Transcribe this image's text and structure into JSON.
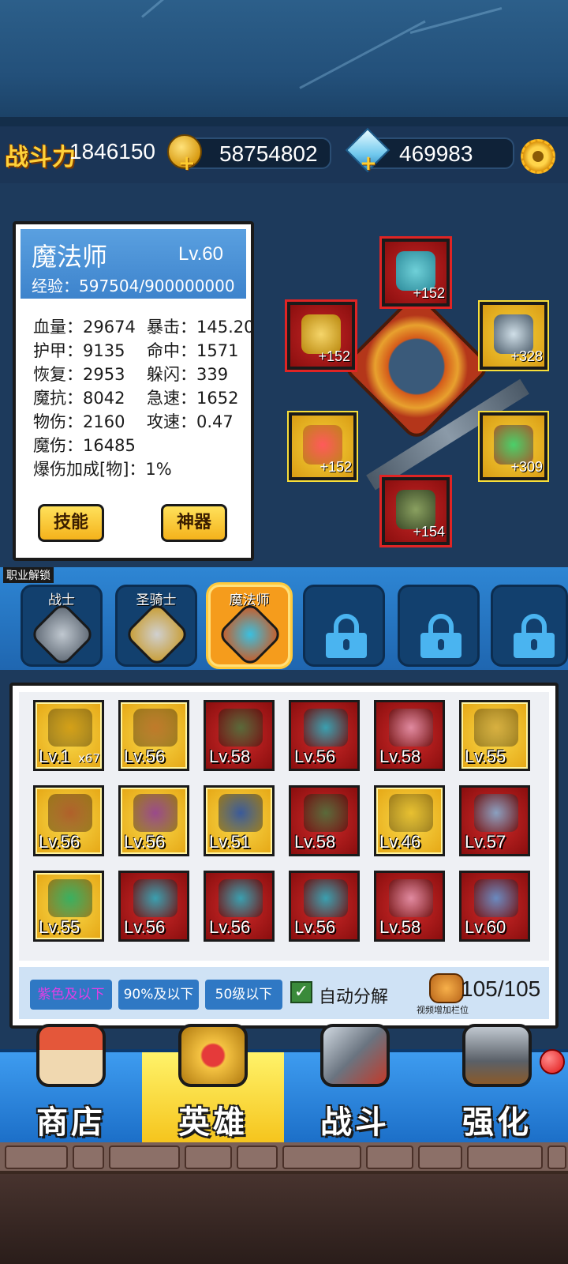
{
  "header": {
    "power_label": "战斗力",
    "power_value": "1846150",
    "gold_value": "58754802",
    "gem_value": "469983",
    "plus_symbol": "+",
    "gear_icon": "gear-icon"
  },
  "hero": {
    "name": "魔法师",
    "level": "Lv.60",
    "exp": "经验：597504/900000000",
    "stats_left": [
      "血量：29674",
      "护甲：9135",
      "恢复：2953",
      "魔抗：8042",
      "物伤：2160",
      "魔伤：16485",
      "爆伤加成[物]：1%"
    ],
    "stats_right": [
      "暴击：145.20",
      "命中：1571",
      "躲闪：339",
      "急速：1652",
      "攻速：0.47"
    ],
    "skill_button": "技能",
    "artifact_button": "神器"
  },
  "equipment": {
    "helmet_plus": "+152",
    "armor_plus": "+152",
    "weapon_plus": "+328",
    "amulet_plus": "+152",
    "ring_plus": "+309",
    "boots_plus": "+154"
  },
  "classes": {
    "bar_label": "职业解锁",
    "items": [
      "战士",
      "圣骑士",
      "魔法师"
    ]
  },
  "inventory": {
    "items": [
      {
        "level": "Lv.1",
        "count": "x67",
        "color": "#e5a614"
      },
      {
        "level": "Lv.56",
        "count": "",
        "color": "#e5a614"
      },
      {
        "level": "Lv.58",
        "count": "",
        "color": "#8a0e0e"
      },
      {
        "level": "Lv.56",
        "count": "",
        "color": "#8a0e0e"
      },
      {
        "level": "Lv.58",
        "count": "",
        "color": "#8a0e0e"
      },
      {
        "level": "Lv.55",
        "count": "",
        "color": "#e5a614"
      },
      {
        "level": "Lv.56",
        "count": "",
        "color": "#e5a614"
      },
      {
        "level": "Lv.56",
        "count": "",
        "color": "#e5a614"
      },
      {
        "level": "Lv.51",
        "count": "",
        "color": "#e5a614"
      },
      {
        "level": "Lv.58",
        "count": "",
        "color": "#8a0e0e"
      },
      {
        "level": "Lv.46",
        "count": "",
        "color": "#e5a614"
      },
      {
        "level": "Lv.57",
        "count": "",
        "color": "#8a0e0e"
      },
      {
        "level": "Lv.55",
        "count": "",
        "color": "#e5a614"
      },
      {
        "level": "Lv.56",
        "count": "",
        "color": "#8a0e0e"
      },
      {
        "level": "Lv.56",
        "count": "",
        "color": "#8a0e0e"
      },
      {
        "level": "Lv.56",
        "count": "",
        "color": "#8a0e0e"
      },
      {
        "level": "Lv.58",
        "count": "",
        "color": "#8a0e0e"
      },
      {
        "level": "Lv.60",
        "count": "",
        "color": "#8a0e0e"
      }
    ],
    "filter_purple": "紫色及以下",
    "filter_90": "90%及以下",
    "filter_50": "50级以下",
    "auto_decompose": "自动分解",
    "bag_count": "105/105",
    "bag_hint": "视频增加栏位",
    "check_mark": "✓"
  },
  "nav": {
    "shop": "商店",
    "hero": "英雄",
    "battle": "战斗",
    "upgrade": "强化"
  }
}
